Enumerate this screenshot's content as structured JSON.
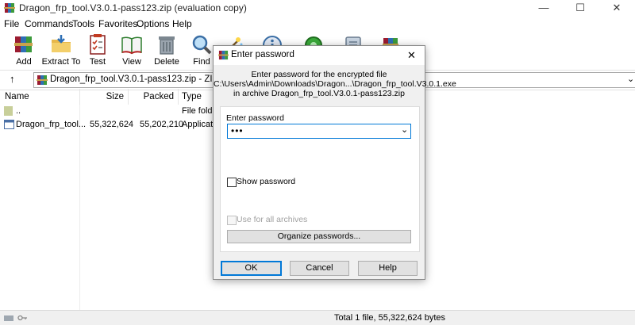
{
  "window": {
    "title": "Dragon_frp_tool.V3.0.1-pass123.zip (evaluation copy)",
    "minimize": "—",
    "maximize": "☐",
    "close": "✕"
  },
  "menu": [
    "File",
    "Commands",
    "Tools",
    "Favorites",
    "Options",
    "Help"
  ],
  "toolbar": [
    {
      "label": "Add",
      "icon": "add-archive-icon"
    },
    {
      "label": "Extract To",
      "icon": "extract-folder-icon"
    },
    {
      "label": "Test",
      "icon": "test-checklist-icon"
    },
    {
      "label": "View",
      "icon": "view-book-icon"
    },
    {
      "label": "Delete",
      "icon": "trash-icon"
    },
    {
      "label": "Find",
      "icon": "magnifier-icon"
    }
  ],
  "address": {
    "up": "↑",
    "text": "Dragon_frp_tool.V3.0.1-pass123.zip - ZIP archive, "
  },
  "list": {
    "columns": [
      "Name",
      "Size",
      "Packed",
      "Type"
    ],
    "rows": [
      {
        "name": "..",
        "size": "",
        "packed": "",
        "type": "File folder"
      },
      {
        "name": "Dragon_frp_tool...",
        "size": "55,322,624",
        "packed": "55,202,210",
        "type": "Applicatio"
      }
    ]
  },
  "status": {
    "text": "Total 1 file, 55,322,624 bytes"
  },
  "dialog": {
    "title": "Enter password",
    "close": "✕",
    "message_line1": "Enter password for the encrypted file",
    "message_line2": "C:\\Users\\Admin\\Downloads\\Dragon...\\Dragon_frp_tool.V3.0.1.exe",
    "message_line3": "in archive Dragon_frp_tool.V3.0.1-pass123.zip",
    "field_label": "Enter password",
    "password_value": "•••",
    "show_password": "Show password",
    "use_for_all": "Use for all archives",
    "organize": "Organize passwords...",
    "ok": "OK",
    "cancel": "Cancel",
    "help": "Help"
  },
  "colors": {
    "accent": "#0078d7",
    "winrar_red": "#9b1c31"
  }
}
